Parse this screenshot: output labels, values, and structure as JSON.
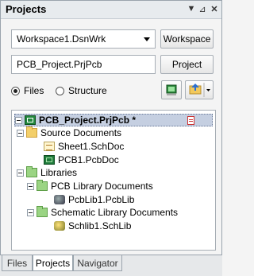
{
  "panel": {
    "title": "Projects",
    "dropdown_icon": "▼",
    "pin_icon": "⊿",
    "close_icon": "✕"
  },
  "workspace": {
    "selected": "Workspace1.DsnWrk",
    "button_label": "Workspace"
  },
  "project": {
    "value": "PCB_Project.PrjPcb",
    "button_label": "Project"
  },
  "view_mode": {
    "files_label": "Files",
    "structure_label": "Structure",
    "selected": "Files"
  },
  "tree": {
    "root": "PCB_Project.PrjPcb *",
    "source_folder": "Source Documents",
    "source_items": [
      "Sheet1.SchDoc",
      "PCB1.PcbDoc"
    ],
    "libraries_folder": "Libraries",
    "pcb_lib_folder": "PCB Library Documents",
    "pcb_lib_item": "PcbLib1.PcbLib",
    "sch_lib_folder": "Schematic Library Documents",
    "sch_lib_item": "Schlib1.SchLib"
  },
  "tabs": [
    {
      "label": "Files"
    },
    {
      "label": "Projects"
    },
    {
      "label": "Navigator"
    }
  ],
  "active_tab": "Projects"
}
